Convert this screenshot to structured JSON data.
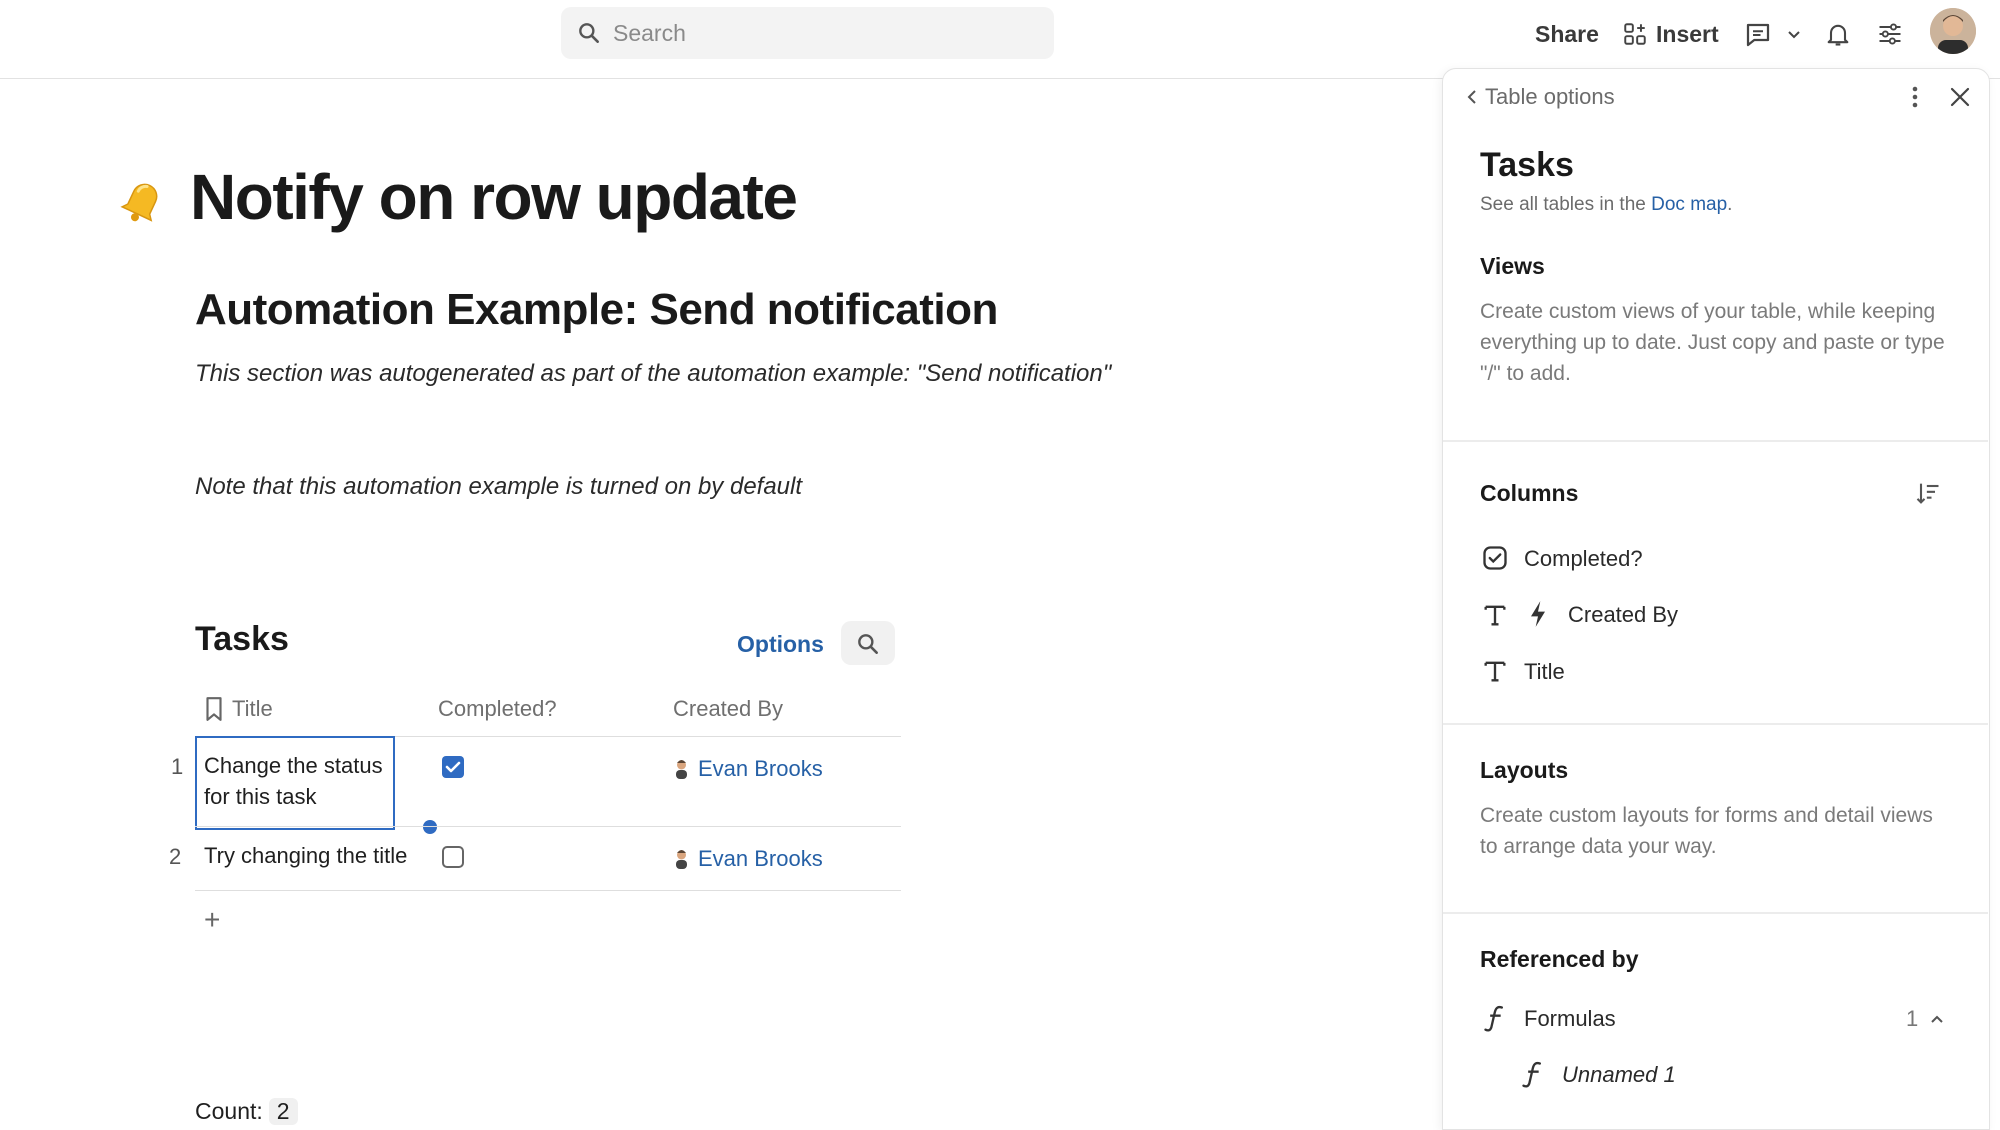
{
  "topbar": {
    "search_placeholder": "Search",
    "share_label": "Share",
    "insert_label": "Insert"
  },
  "doc": {
    "title": "Notify on row update",
    "heading": "Automation Example: Send notification",
    "autogen_note": "This section was autogenerated as part of the automation example: \"Send notification\"",
    "default_note": "Note that this automation example is turned on by default"
  },
  "table": {
    "title": "Tasks",
    "options_label": "Options",
    "columns": [
      "Title",
      "Completed?",
      "Created By"
    ],
    "rows": [
      {
        "num": "1",
        "title_line1": "Change the status",
        "title_line2": "for this task",
        "completed": true,
        "created_by": "Evan Brooks"
      },
      {
        "num": "2",
        "title_line1": "Try changing the title",
        "title_line2": "",
        "completed": false,
        "created_by": "Evan Brooks"
      }
    ],
    "add_row": "+",
    "count_label": "Count:",
    "count_value": "2"
  },
  "panel": {
    "back_label": "Table options",
    "title": "Tasks",
    "subtitle_prefix": "See all tables in the ",
    "subtitle_link": "Doc map",
    "subtitle_suffix": ".",
    "views_title": "Views",
    "views_desc": "Create custom views of your table, while keeping everything up to date. Just copy and paste or type \"/\" to add.",
    "columns_title": "Columns",
    "columns": [
      {
        "label": "Completed?",
        "icon": "checkbox-icon"
      },
      {
        "label": "Created By",
        "icon": "text-icon"
      },
      {
        "label": "Title",
        "icon": "text-icon"
      }
    ],
    "layouts_title": "Layouts",
    "layouts_desc": "Create custom layouts for forms and detail views to arrange data your way.",
    "referenced_title": "Referenced by",
    "formulas_label": "Formulas",
    "formulas_count": "1",
    "formula_item": "Unnamed 1"
  },
  "colors": {
    "accent": "#2660a6",
    "selection": "#2f6bc2"
  }
}
